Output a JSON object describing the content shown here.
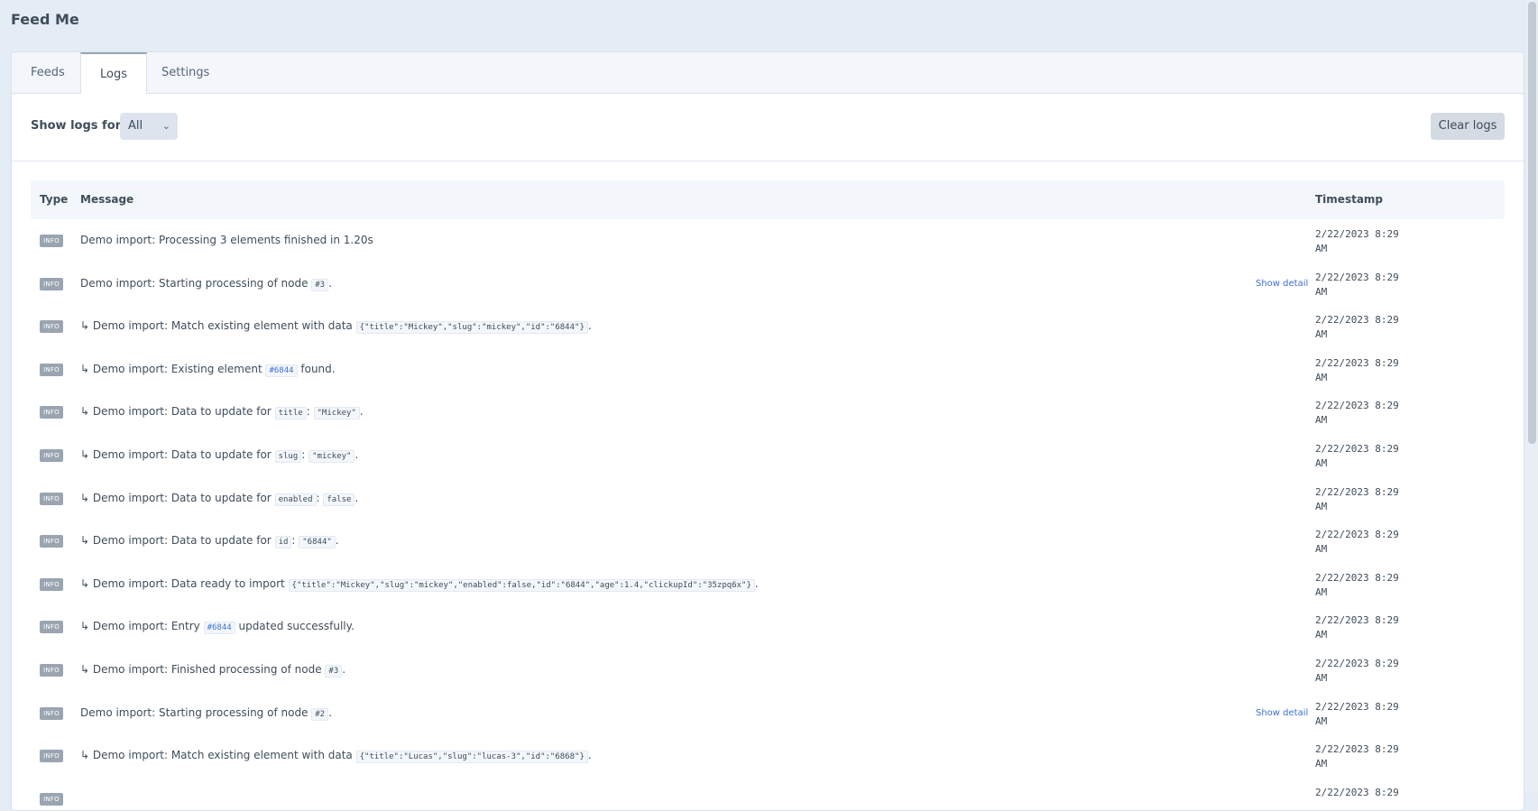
{
  "app": {
    "title": "Feed Me"
  },
  "tabs": [
    {
      "label": "Feeds",
      "active": false
    },
    {
      "label": "Logs",
      "active": true
    },
    {
      "label": "Settings",
      "active": false
    }
  ],
  "toolbar": {
    "filter_label": "Show logs for:",
    "filter_value": "All",
    "clear_label": "Clear logs"
  },
  "table": {
    "headers": {
      "type": "Type",
      "message": "Message",
      "timestamp": "Timestamp"
    },
    "rows": [
      {
        "type": "INFO",
        "parts": [
          {
            "t": "Demo import: Processing 3 elements finished in 1.20s"
          }
        ],
        "detail": "",
        "ts1": "2/22/2023 8:29",
        "ts2": "AM"
      },
      {
        "type": "INFO",
        "parts": [
          {
            "t": "Demo import: Starting processing of node "
          },
          {
            "c": "#3"
          },
          {
            "t": "."
          }
        ],
        "detail": "Show detail",
        "ts1": "2/22/2023 8:29",
        "ts2": "AM"
      },
      {
        "type": "INFO",
        "parts": [
          {
            "t": "↳ Demo import: Match existing element with data "
          },
          {
            "c": "{\"title\":\"Mickey\",\"slug\":\"mickey\",\"id\":\"6844\"}"
          },
          {
            "t": "."
          }
        ],
        "detail": "",
        "ts1": "2/22/2023 8:29",
        "ts2": "AM"
      },
      {
        "type": "INFO",
        "parts": [
          {
            "t": "↳ Demo import: Existing element "
          },
          {
            "l": "#6844"
          },
          {
            "t": " found."
          }
        ],
        "detail": "",
        "ts1": "2/22/2023 8:29",
        "ts2": "AM"
      },
      {
        "type": "INFO",
        "parts": [
          {
            "t": "↳ Demo import: Data to update for "
          },
          {
            "c": "title"
          },
          {
            "t": ": "
          },
          {
            "c": "\"Mickey\""
          },
          {
            "t": "."
          }
        ],
        "detail": "",
        "ts1": "2/22/2023 8:29",
        "ts2": "AM"
      },
      {
        "type": "INFO",
        "parts": [
          {
            "t": "↳ Demo import: Data to update for "
          },
          {
            "c": "slug"
          },
          {
            "t": ": "
          },
          {
            "c": "\"mickey\""
          },
          {
            "t": "."
          }
        ],
        "detail": "",
        "ts1": "2/22/2023 8:29",
        "ts2": "AM"
      },
      {
        "type": "INFO",
        "parts": [
          {
            "t": "↳ Demo import: Data to update for "
          },
          {
            "c": "enabled"
          },
          {
            "t": ": "
          },
          {
            "c": "false"
          },
          {
            "t": "."
          }
        ],
        "detail": "",
        "ts1": "2/22/2023 8:29",
        "ts2": "AM"
      },
      {
        "type": "INFO",
        "parts": [
          {
            "t": "↳ Demo import: Data to update for "
          },
          {
            "c": "id"
          },
          {
            "t": ": "
          },
          {
            "c": "\"6844\""
          },
          {
            "t": "."
          }
        ],
        "detail": "",
        "ts1": "2/22/2023 8:29",
        "ts2": "AM"
      },
      {
        "type": "INFO",
        "parts": [
          {
            "t": "↳ Demo import: Data ready to import "
          },
          {
            "c": "{\"title\":\"Mickey\",\"slug\":\"mickey\",\"enabled\":false,\"id\":\"6844\",\"age\":1.4,\"clickupId\":\"35zpq6x\"}"
          },
          {
            "t": "."
          }
        ],
        "detail": "",
        "ts1": "2/22/2023 8:29",
        "ts2": "AM"
      },
      {
        "type": "INFO",
        "parts": [
          {
            "t": "↳ Demo import: Entry "
          },
          {
            "l": "#6844"
          },
          {
            "t": " updated successfully."
          }
        ],
        "detail": "",
        "ts1": "2/22/2023 8:29",
        "ts2": "AM"
      },
      {
        "type": "INFO",
        "parts": [
          {
            "t": "↳ Demo import: Finished processing of node "
          },
          {
            "c": "#3"
          },
          {
            "t": "."
          }
        ],
        "detail": "",
        "ts1": "2/22/2023 8:29",
        "ts2": "AM"
      },
      {
        "type": "INFO",
        "parts": [
          {
            "t": "Demo import: Starting processing of node "
          },
          {
            "c": "#2"
          },
          {
            "t": "."
          }
        ],
        "detail": "Show detail",
        "ts1": "2/22/2023 8:29",
        "ts2": "AM"
      },
      {
        "type": "INFO",
        "parts": [
          {
            "t": "↳ Demo import: Match existing element with data "
          },
          {
            "c": "{\"title\":\"Lucas\",\"slug\":\"lucas-3\",\"id\":\"6868\"}"
          },
          {
            "t": "."
          }
        ],
        "detail": "",
        "ts1": "2/22/2023 8:29",
        "ts2": "AM"
      },
      {
        "type": "INFO",
        "parts": [
          {
            "t": ""
          }
        ],
        "detail": "",
        "ts1": "2/22/2023 8:29",
        "ts2": ""
      }
    ]
  }
}
